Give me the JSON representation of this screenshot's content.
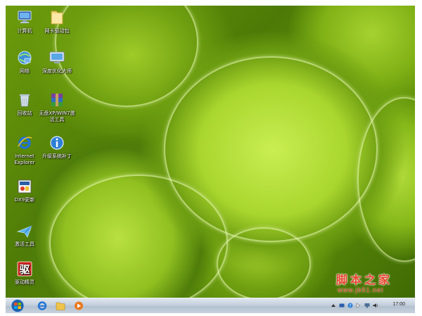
{
  "desktop": {
    "icons": [
      {
        "label": "计算机",
        "icon": "computer-icon"
      },
      {
        "label": "网卡驱动包",
        "icon": "folder-icon"
      },
      {
        "label": "网络",
        "icon": "network-icon"
      },
      {
        "label": "深度优化大师",
        "icon": "monitor-icon"
      },
      {
        "label": "回收站",
        "icon": "recycle-bin-icon"
      },
      {
        "label": "无盘XP/WIN7激活工具",
        "icon": "winrar-icon"
      },
      {
        "label": "Internet Explorer",
        "icon": "ie-icon"
      },
      {
        "label": "升级系统补丁",
        "icon": "info-icon"
      },
      {
        "label": "DX9更新",
        "icon": "dx-installer-icon"
      },
      {
        "label": "激活工具",
        "icon": "paper-plane-icon"
      },
      {
        "label": "驱动精灵",
        "icon": "driver-genius-icon"
      }
    ],
    "icon_glyphs": {
      "driver_genius": "驱"
    }
  },
  "taskbar": {
    "start_label": "Start",
    "pinned": [
      "ie-icon",
      "explorer-icon",
      "media-player-icon"
    ],
    "clock": "17:00"
  },
  "watermark": {
    "title": "脚本之家",
    "url": "www.jb51.net"
  },
  "colors": {
    "taskbar": "#c4cfdc",
    "watermark": "#e8452e"
  }
}
